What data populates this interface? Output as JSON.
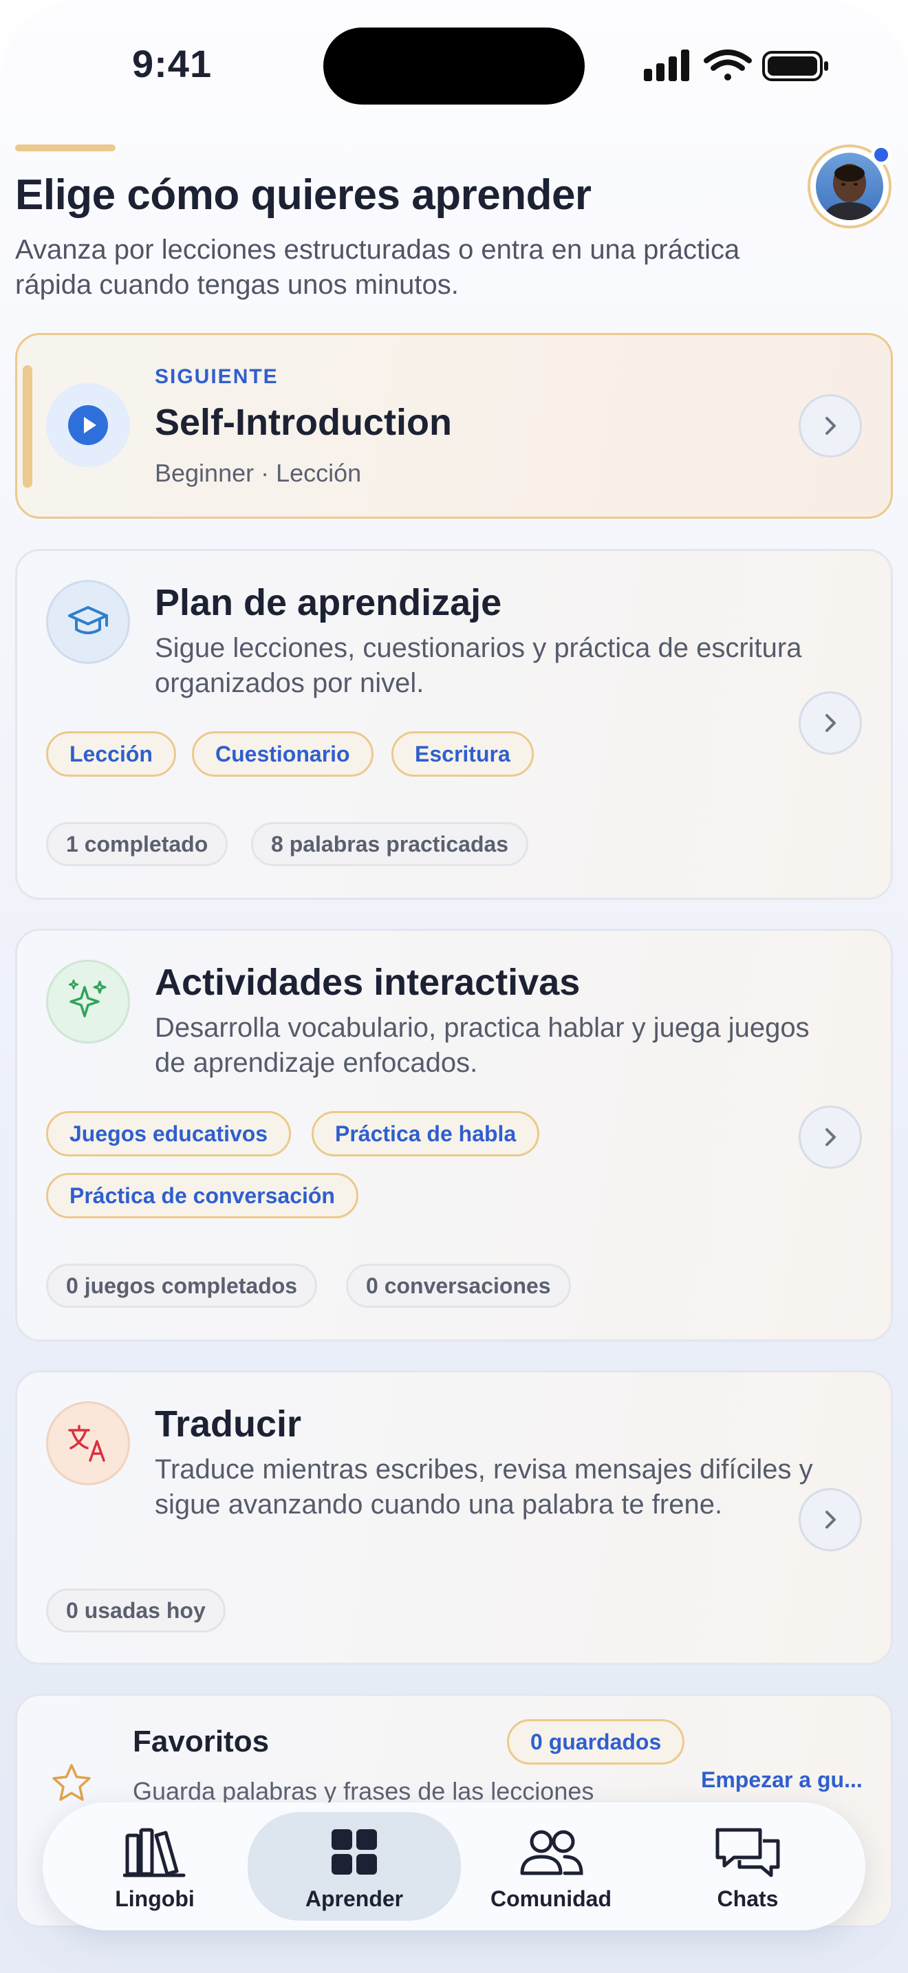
{
  "status_bar": {
    "time": "9:41"
  },
  "header": {
    "title": "Elige cómo quieres aprender",
    "subtitle": "Avanza por lecciones estructuradas o entra en una práctica rápida cuando tengas unos minutos."
  },
  "next_card": {
    "eyebrow": "SIGUIENTE",
    "title": "Self-Introduction",
    "meta": "Beginner · Lección",
    "icon": "play-icon"
  },
  "cards": [
    {
      "title": "Plan de aprendizaje",
      "description": "Sigue lecciones, cuestionarios y práctica de escritura organizados por nivel.",
      "icon": "graduation-cap-icon",
      "chips": [
        "Lección",
        "Cuestionario",
        "Escritura"
      ],
      "stats": [
        "1 completado",
        "8 palabras practicadas"
      ]
    },
    {
      "title": "Actividades interactivas",
      "description": "Desarrolla vocabulario, practica hablar y juega juegos de aprendizaje enfocados.",
      "icon": "sparkles-icon",
      "chips": [
        "Juegos educativos",
        "Práctica de habla",
        "Práctica de conversación"
      ],
      "stats": [
        "0 juegos completados",
        "0 conversaciones"
      ]
    },
    {
      "title": "Traducir",
      "description": "Traduce mientras escribes, revisa mensajes difíciles y sigue avanzando cuando una palabra te frene.",
      "icon": "translate-icon",
      "stats": [
        "0 usadas hoy"
      ]
    }
  ],
  "favorites": {
    "title": "Favoritos",
    "badge": "0 guardados",
    "description": "Guarda palabras y frases de las lecciones",
    "action": "Empezar a gu...",
    "icon": "star-icon"
  },
  "bottom_nav": [
    {
      "label": "Lingobi",
      "icon": "books-icon",
      "active": false
    },
    {
      "label": "Aprender",
      "icon": "grid-icon",
      "active": true
    },
    {
      "label": "Comunidad",
      "icon": "people-icon",
      "active": false
    },
    {
      "label": "Chats",
      "icon": "chat-bubbles-icon",
      "active": false
    }
  ],
  "colors": {
    "accent_gold": "#ecc98c",
    "link_blue": "#2f5fcf",
    "text_dark": "#1c2233"
  }
}
